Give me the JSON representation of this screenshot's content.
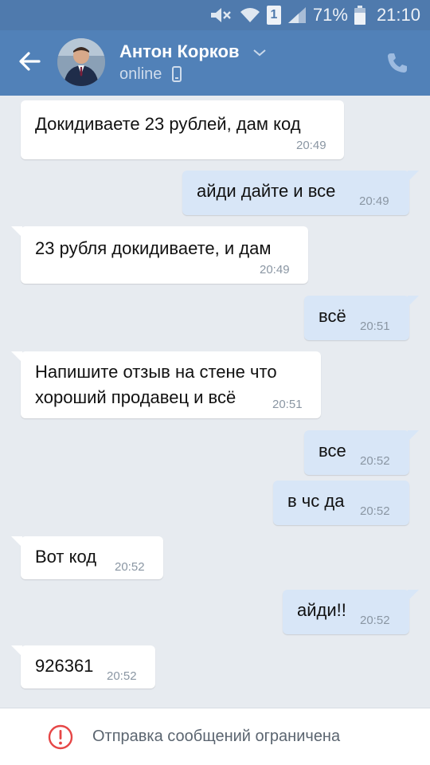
{
  "status_bar": {
    "battery_percent": "71%",
    "time": "21:10",
    "sim_slot": "1"
  },
  "header": {
    "contact_name": "Антон Корков",
    "status": "online",
    "icons": {
      "back": "arrow-left-icon",
      "dropdown": "chevron-down-icon",
      "device": "mobile-phone-icon",
      "call": "phone-icon"
    }
  },
  "messages": [
    {
      "direction": "in",
      "text": "Докидиваете 23 рублей, дам код",
      "time": "20:49"
    },
    {
      "direction": "out",
      "text": "айди дайте и все",
      "time": "20:49"
    },
    {
      "direction": "in",
      "text": "23 рубля докидиваете, и дам",
      "time": "20:49"
    },
    {
      "direction": "out",
      "text": "всё",
      "time": "20:51"
    },
    {
      "direction": "in",
      "text": "Напишите отзыв на стене что\nхороший продавец и всё",
      "time": "20:51"
    },
    {
      "direction": "out",
      "text": "все",
      "time": "20:52"
    },
    {
      "direction": "out",
      "text": "в чс да",
      "time": "20:52"
    },
    {
      "direction": "in",
      "text": "Вот код",
      "time": "20:52"
    },
    {
      "direction": "out",
      "text": "айди!!",
      "time": "20:52"
    },
    {
      "direction": "in",
      "text": "926361",
      "time": "20:52"
    }
  ],
  "bottom_bar": {
    "restricted_text": "Отправка сообщений ограничена",
    "icon": "alert-circle-icon"
  },
  "colors": {
    "header": "#5181b8",
    "status_bar": "#4f7aad",
    "chat_background": "#e7ebf0",
    "incoming_bubble": "#ffffff",
    "outgoing_bubble": "#d8e6f7",
    "warning": "#e64646"
  }
}
